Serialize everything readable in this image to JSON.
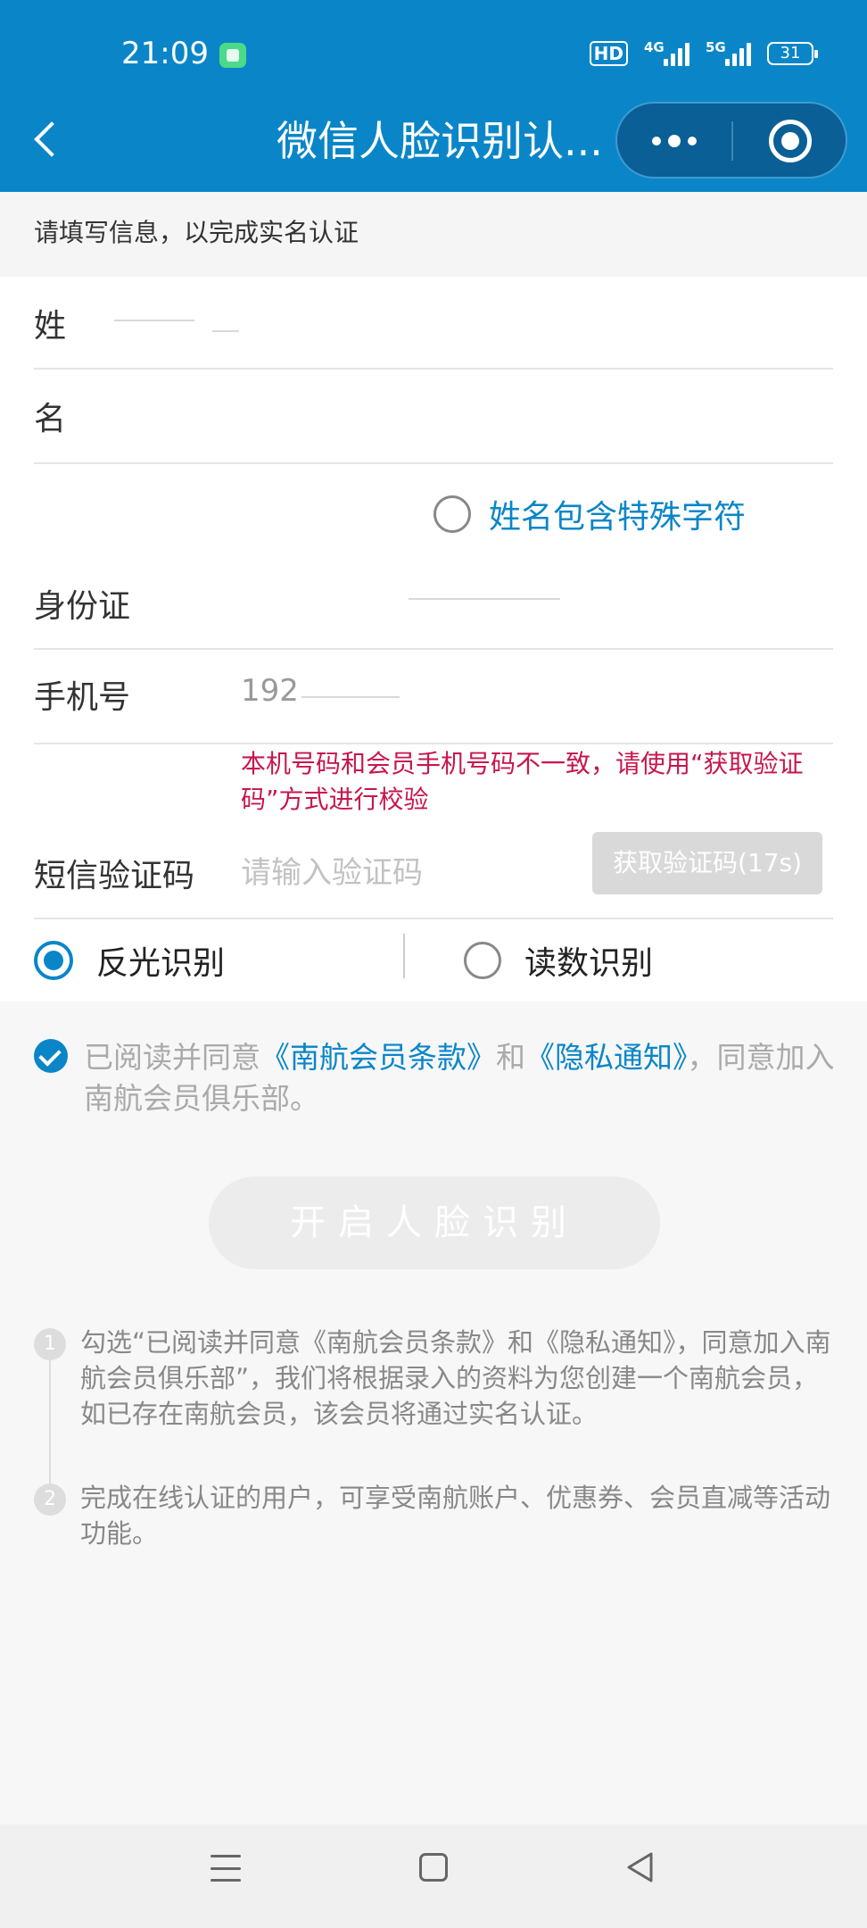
{
  "status_bar": {
    "time": "21:09",
    "hd": "HD",
    "net1": "4G",
    "net2": "5G",
    "battery": "31"
  },
  "header": {
    "title": "微信人脸识别认...",
    "back_icon": "back-chevron-icon",
    "more_icon": "more-dots-icon",
    "close_icon": "close-target-icon"
  },
  "notice": "请填写信息，以完成实名认证",
  "form": {
    "surname_label": "姓",
    "given_label": "名",
    "special_chars": "姓名包含特殊字符",
    "id_label": "身份证",
    "phone_label": "手机号",
    "phone_value": "192",
    "phone_error": "本机号码和会员手机号码不一致，请使用“获取验证码”方式进行校验",
    "sms_label": "短信验证码",
    "sms_placeholder": "请输入验证码",
    "get_code_button": "获取验证码(17s)",
    "mode_reflect": "反光识别",
    "mode_read": "读数识别"
  },
  "agreement": {
    "prefix": "已阅读并同意",
    "link1": "《南航会员条款》",
    "and": "和",
    "link2": "《隐私通知》",
    "suffix": "，同意加入南航会员俱乐部。"
  },
  "face_button": "开启人脸识别",
  "tips": [
    {
      "num": "1",
      "text": "勾选“已阅读并同意《南航会员条款》和《隐私通知》，同意加入南航会员俱乐部”，我们将根据录入的资料为您创建一个南航会员，如已存在南航会员，该会员将通过实名认证。"
    },
    {
      "num": "2",
      "text": "完成在线认证的用户，可享受南航账户、优惠券、会员直减等活动功能。"
    }
  ],
  "colors": {
    "header": "#0a86c8",
    "link": "#0a86c8",
    "error": "#c7164e"
  }
}
